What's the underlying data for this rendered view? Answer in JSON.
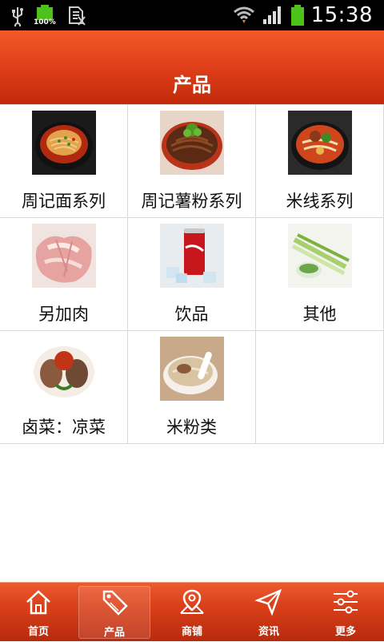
{
  "status": {
    "time": "15:38",
    "battery_text": "100%"
  },
  "header": {
    "title": "产品"
  },
  "products": [
    {
      "label": "周记面系列"
    },
    {
      "label": "周记薯粉系列"
    },
    {
      "label": "米线系列"
    },
    {
      "label": "另加肉"
    },
    {
      "label": "饮品"
    },
    {
      "label": "其他"
    },
    {
      "label": "卤菜：凉菜"
    },
    {
      "label": "米粉类"
    }
  ],
  "tabs": [
    {
      "label": "首页",
      "icon": "home-icon"
    },
    {
      "label": "产品",
      "icon": "sale-tag-icon",
      "active": true
    },
    {
      "label": "商铺",
      "icon": "map-pin-icon"
    },
    {
      "label": "资讯",
      "icon": "paper-plane-icon"
    },
    {
      "label": "更多",
      "icon": "sliders-icon"
    }
  ],
  "colors": {
    "brand": "#e2411b",
    "statusbar": "#000000",
    "battery": "#4cc21a"
  }
}
